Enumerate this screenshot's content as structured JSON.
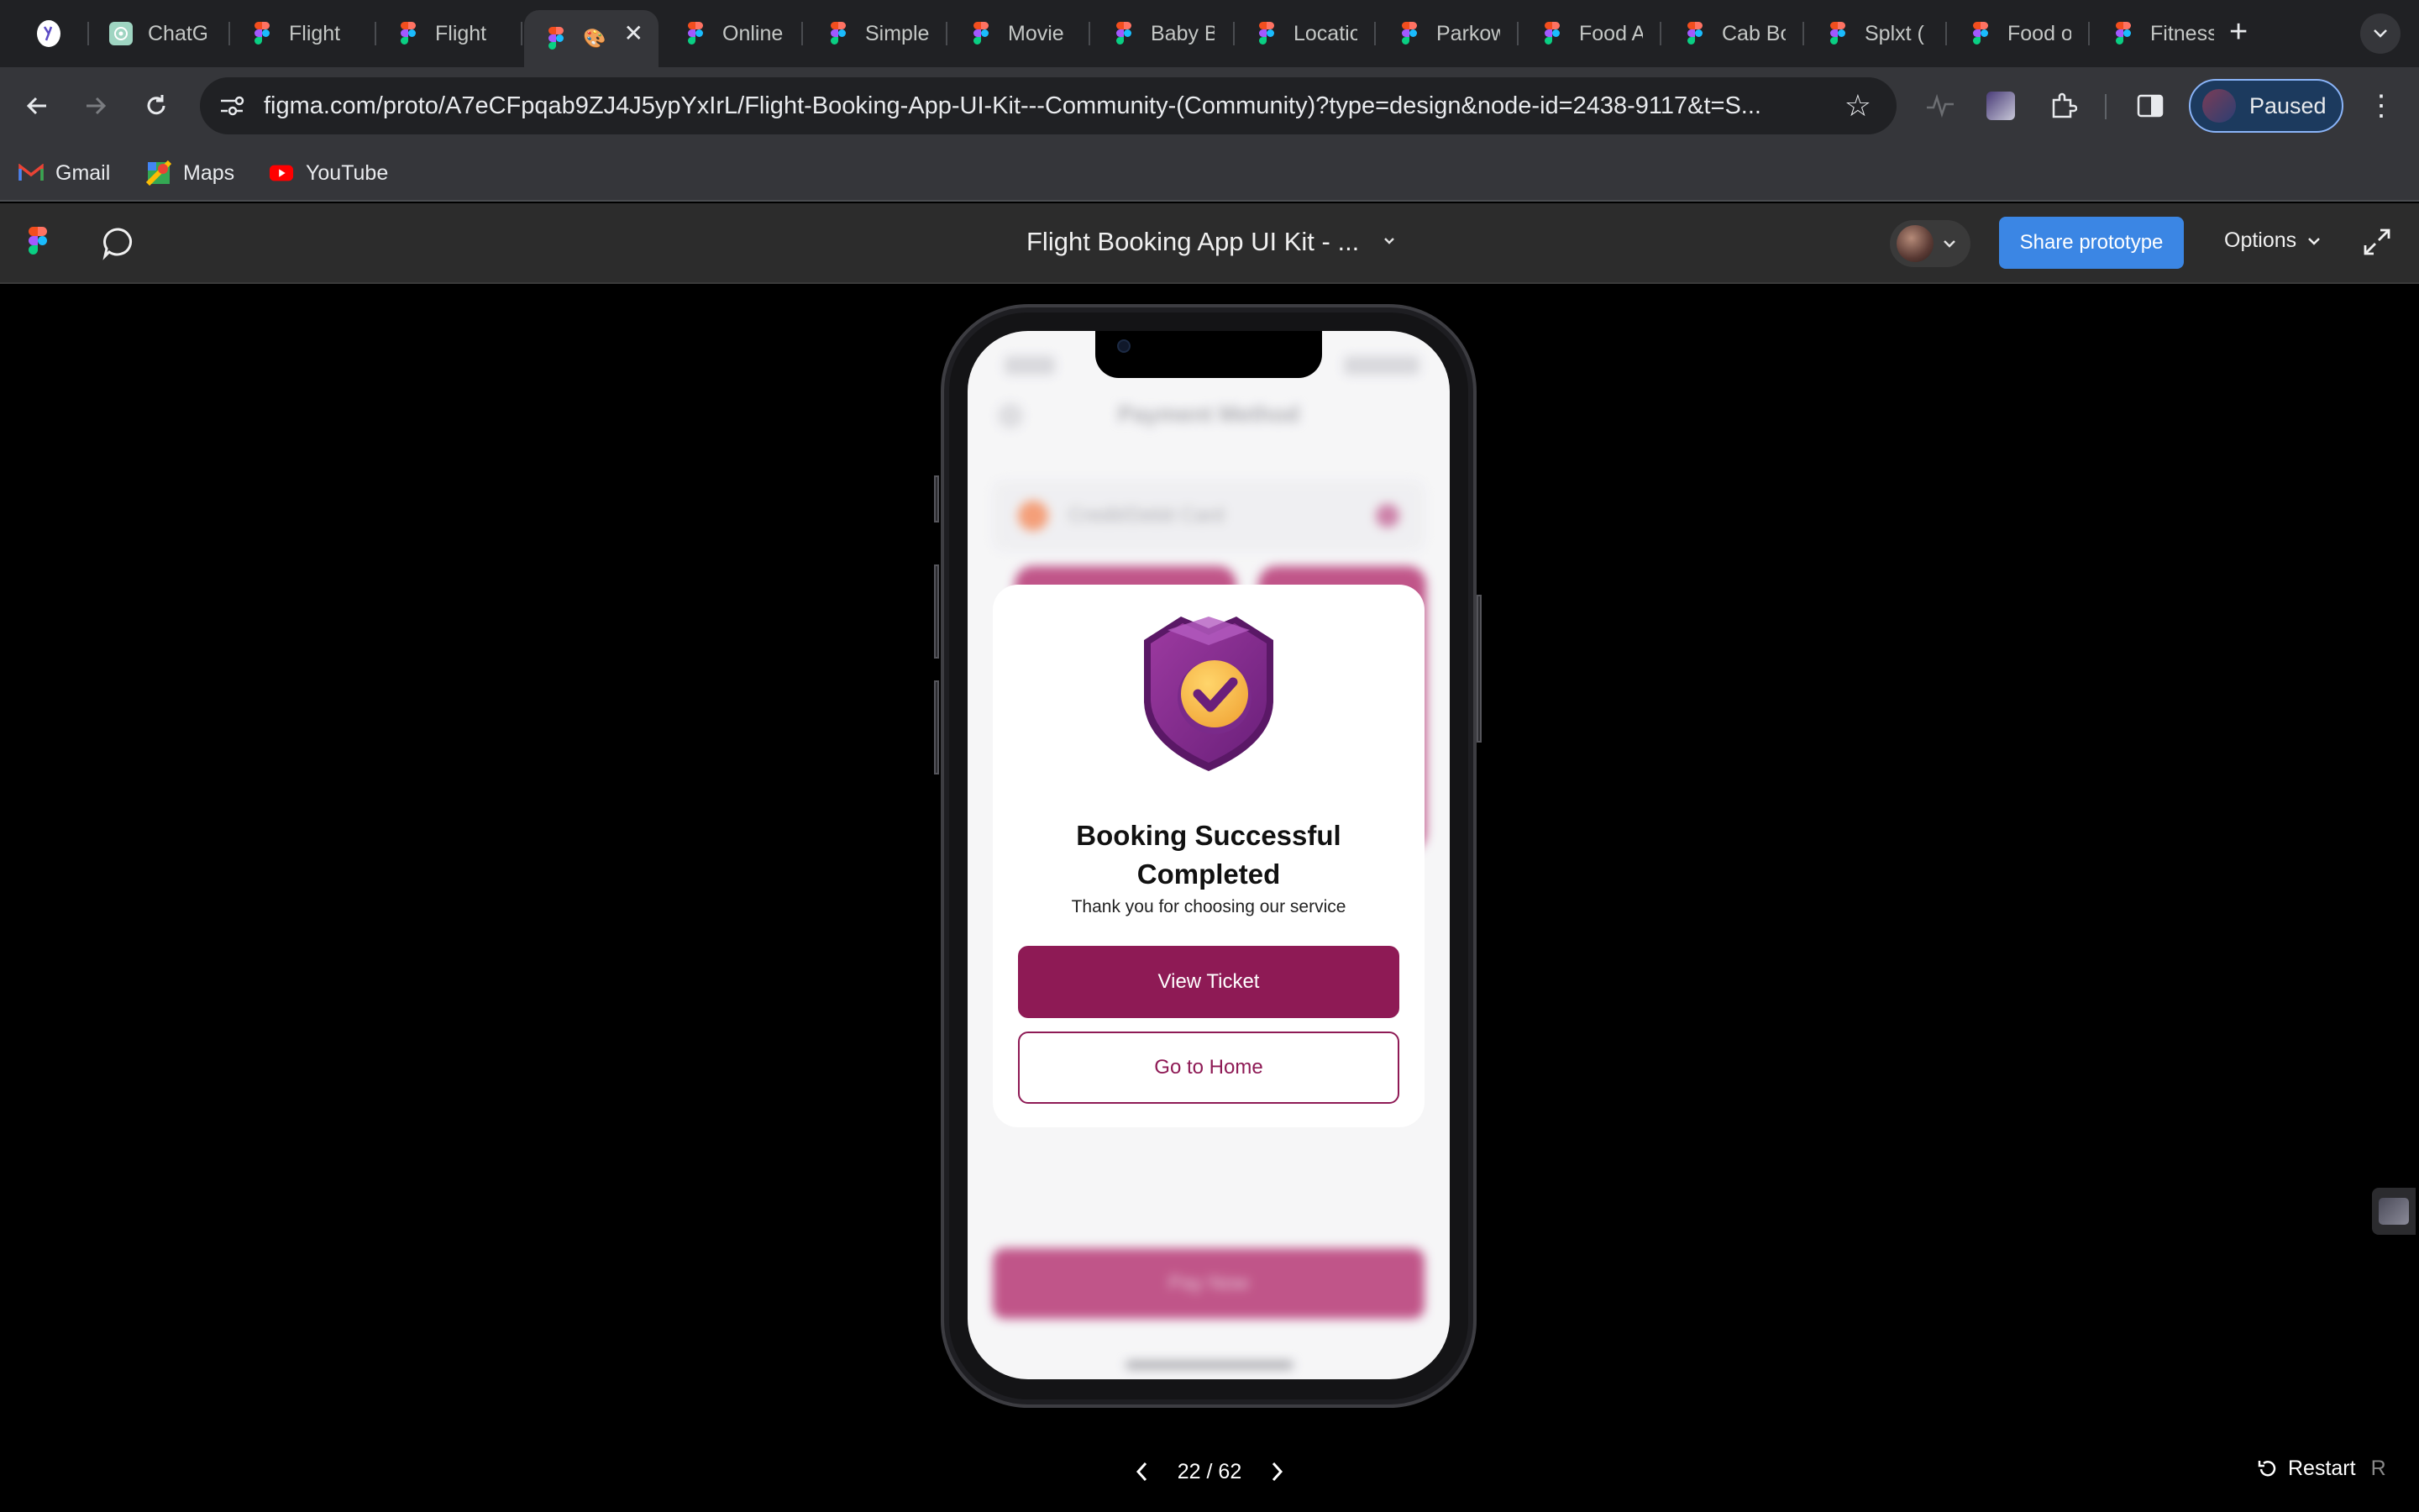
{
  "browser": {
    "tabs": [
      {
        "label": "",
        "kind": "app",
        "active": false
      },
      {
        "label": "ChatGPT",
        "kind": "chatgpt",
        "active": false
      },
      {
        "label": "Flight B",
        "kind": "figma",
        "active": false
      },
      {
        "label": "Flight B",
        "kind": "figma",
        "active": false
      },
      {
        "label": "🎨",
        "kind": "figma",
        "active": true
      },
      {
        "label": "Online",
        "kind": "figma",
        "active": false
      },
      {
        "label": "Simple",
        "kind": "figma",
        "active": false
      },
      {
        "label": "Movie",
        "kind": "figma",
        "active": false
      },
      {
        "label": "Baby B",
        "kind": "figma",
        "active": false
      },
      {
        "label": "Locatio",
        "kind": "figma",
        "active": false
      },
      {
        "label": "Parkow",
        "kind": "figma",
        "active": false
      },
      {
        "label": "Food A",
        "kind": "figma",
        "active": false
      },
      {
        "label": "Cab Bo",
        "kind": "figma",
        "active": false
      },
      {
        "label": "Splxt (",
        "kind": "figma",
        "active": false
      },
      {
        "label": "Food o",
        "kind": "figma",
        "active": false
      },
      {
        "label": "Fitness",
        "kind": "figma",
        "active": false
      }
    ],
    "url": "figma.com/proto/A7eCFpqab9ZJ4J5ypYxIrL/Flight-Booking-App-UI-Kit---Community-(Community)?type=design&node-id=2438-9117&t=S...",
    "profile_label": "Paused",
    "bookmarks": [
      {
        "label": "Gmail",
        "icon": "gmail-icon"
      },
      {
        "label": "Maps",
        "icon": "maps-icon"
      },
      {
        "label": "YouTube",
        "icon": "youtube-icon"
      }
    ]
  },
  "figma": {
    "title": "Flight Booking App UI Kit - ...",
    "share_label": "Share prototype",
    "options_label": "Options"
  },
  "app": {
    "background_header": "Payment Method",
    "background_card_label": "Credit/Debit Card",
    "background_pay_button": "Pay Now",
    "modal": {
      "title_line1": "Booking Successful",
      "title_line2": "Completed",
      "subtitle": "Thank you for choosing our service",
      "primary_button": "View Ticket",
      "secondary_button": "Go to Home"
    }
  },
  "footer": {
    "page_counter": "22 / 62",
    "restart_label": "Restart",
    "restart_shortcut": "R"
  },
  "colors": {
    "brand": "#8e1a55",
    "share_blue": "#3b86e4"
  }
}
